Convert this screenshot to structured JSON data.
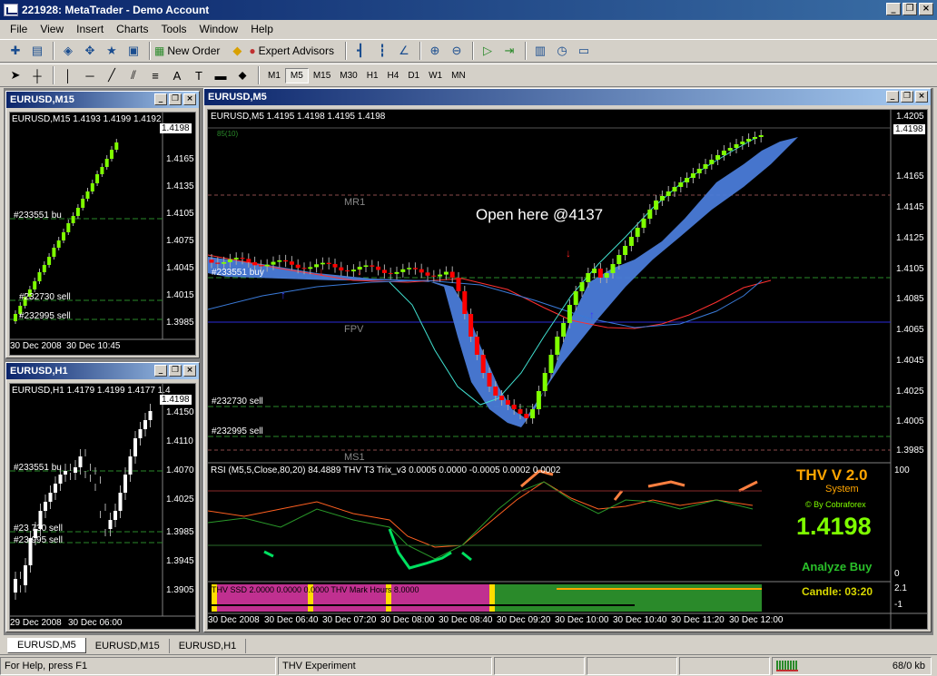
{
  "app": {
    "title": "221928: MetaTrader - Demo Account"
  },
  "menu": [
    "File",
    "View",
    "Insert",
    "Charts",
    "Tools",
    "Window",
    "Help"
  ],
  "toolbar": {
    "new_order": "New Order",
    "expert_advisors": "Expert Advisors"
  },
  "timeframes": [
    "M1",
    "M5",
    "M15",
    "M30",
    "H1",
    "H4",
    "D1",
    "W1",
    "MN"
  ],
  "active_timeframe": "M5",
  "windows": {
    "m15": {
      "title": "EURUSD,M15",
      "header": "EURUSD,M15  1.4193 1.4199 1.4192",
      "price_tag": "1.4198",
      "scale": [
        "1.4165",
        "1.4135",
        "1.4105",
        "1.4075",
        "1.4045",
        "1.4015",
        "1.3985"
      ],
      "labels": [
        "#233551 bu",
        "#232730 sell",
        "#232995 sell"
      ],
      "times": [
        "30 Dec 2008",
        "30 Dec 10:45"
      ]
    },
    "h1": {
      "title": "EURUSD,H1",
      "header": "EURUSD,H1  1.4179 1.4199 1.4177 1.4",
      "price_tag": "1.4198",
      "scale": [
        "1.4150",
        "1.4110",
        "1.4070",
        "1.4025",
        "1.3985",
        "1.3945",
        "1.3905"
      ],
      "labels": [
        "#233551 bu",
        "#23 730 sell",
        "#23 995 sell"
      ],
      "times": [
        "29 Dec 2008",
        "30 Dec 06:00"
      ]
    },
    "m5": {
      "title": "EURUSD,M5",
      "header": "EURUSD,M5  1.4195 1.4198 1.4195 1.4198",
      "indicator_small": "85(10)",
      "price_tag": "1.4198",
      "scale": [
        "1.4205",
        "1.4165",
        "1.4145",
        "1.4125",
        "1.4105",
        "1.4085",
        "1.4065",
        "1.4045",
        "1.4025",
        "1.4005",
        "1.3985"
      ],
      "level_labels": {
        "mr1": "MR1",
        "fpv": "FPV",
        "ms1": "MS1"
      },
      "order_labels": [
        "#233551 buy",
        "#232730 sell",
        "#232995 sell"
      ],
      "annotation": "Open here @4137",
      "sub_header": "RSI (M5,5,Close,80,20) 84.4889    THV T3 Trix_v3  0.0005 0.0000 -0.0005 0.0002 0.0002",
      "sub_scale": [
        "100",
        "0"
      ],
      "bottom_text": "THV SSD 2.0000 0.0000 0.0000  THV Mark     Hours 8.0000",
      "bottom_scale": [
        "2.1",
        "-1"
      ],
      "thv_title": "THV V 2.0",
      "thv_system": "System",
      "thv_by": "© By Cobraforex",
      "thv_price": "1.4198",
      "thv_analyze": "Analyze Buy",
      "thv_candle": "Candle:  03:20",
      "times": [
        "30 Dec 2008",
        "30 Dec 06:40",
        "30 Dec 07:20",
        "30 Dec 08:00",
        "30 Dec 08:40",
        "30 Dec 09:20",
        "30 Dec 10:00",
        "30 Dec 10:40",
        "30 Dec 11:20",
        "30 Dec 12:00"
      ]
    }
  },
  "tabs": [
    "EURUSD,M5",
    "EURUSD,M15",
    "EURUSD,H1"
  ],
  "status": {
    "help": "For Help, press F1",
    "profile": "THV Experiment",
    "traffic": "68/0 kb"
  },
  "colors": {
    "bull": "#7fff00",
    "bear": "#ff0000",
    "cloud": "#4a7bd8",
    "title_bar": "#0a246a",
    "thv_orange": "#ffa500",
    "thv_green": "#7fff00"
  }
}
